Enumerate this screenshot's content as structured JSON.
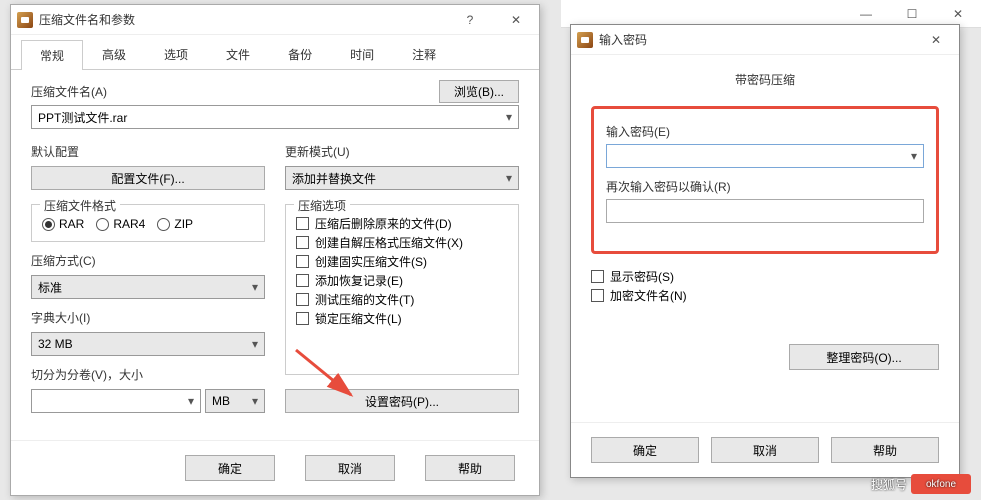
{
  "back_window": {
    "min": "—",
    "max": "☐",
    "close": "✕"
  },
  "dialog1": {
    "title": "压缩文件名和参数",
    "controls": {
      "help": "?",
      "close": "✕"
    },
    "tabs": [
      "常规",
      "高级",
      "选项",
      "文件",
      "备份",
      "时间",
      "注释"
    ],
    "active_tab": 0,
    "filename_label": "压缩文件名(A)",
    "browse_btn": "浏览(B)...",
    "filename_value": "PPT测试文件.rar",
    "default_config_label": "默认配置",
    "config_btn": "配置文件(F)...",
    "update_mode_label": "更新模式(U)",
    "update_mode_value": "添加并替换文件",
    "format_legend": "压缩文件格式",
    "format_options": [
      "RAR",
      "RAR4",
      "ZIP"
    ],
    "format_selected": 0,
    "compress_options_legend": "压缩选项",
    "compress_options": [
      "压缩后删除原来的文件(D)",
      "创建自解压格式压缩文件(X)",
      "创建固实压缩文件(S)",
      "添加恢复记录(E)",
      "测试压缩的文件(T)",
      "锁定压缩文件(L)"
    ],
    "method_label": "压缩方式(C)",
    "method_value": "标准",
    "dict_label": "字典大小(I)",
    "dict_value": "32 MB",
    "split_label": "切分为分卷(V)，大小",
    "split_value": "",
    "split_unit": "MB",
    "set_password_btn": "设置密码(P)...",
    "footer": {
      "ok": "确定",
      "cancel": "取消",
      "help": "帮助"
    }
  },
  "dialog2": {
    "title": "输入密码",
    "close": "✕",
    "subtitle": "带密码压缩",
    "pw1_label": "输入密码(E)",
    "pw1_value": "",
    "pw2_label": "再次输入密码以确认(R)",
    "pw2_value": "",
    "show_pw": "显示密码(S)",
    "encrypt_names": "加密文件名(N)",
    "organize_btn": "整理密码(O)...",
    "footer": {
      "ok": "确定",
      "cancel": "取消",
      "help": "帮助"
    }
  },
  "watermark": {
    "text1": "搜狐号",
    "text2": "okfone"
  }
}
